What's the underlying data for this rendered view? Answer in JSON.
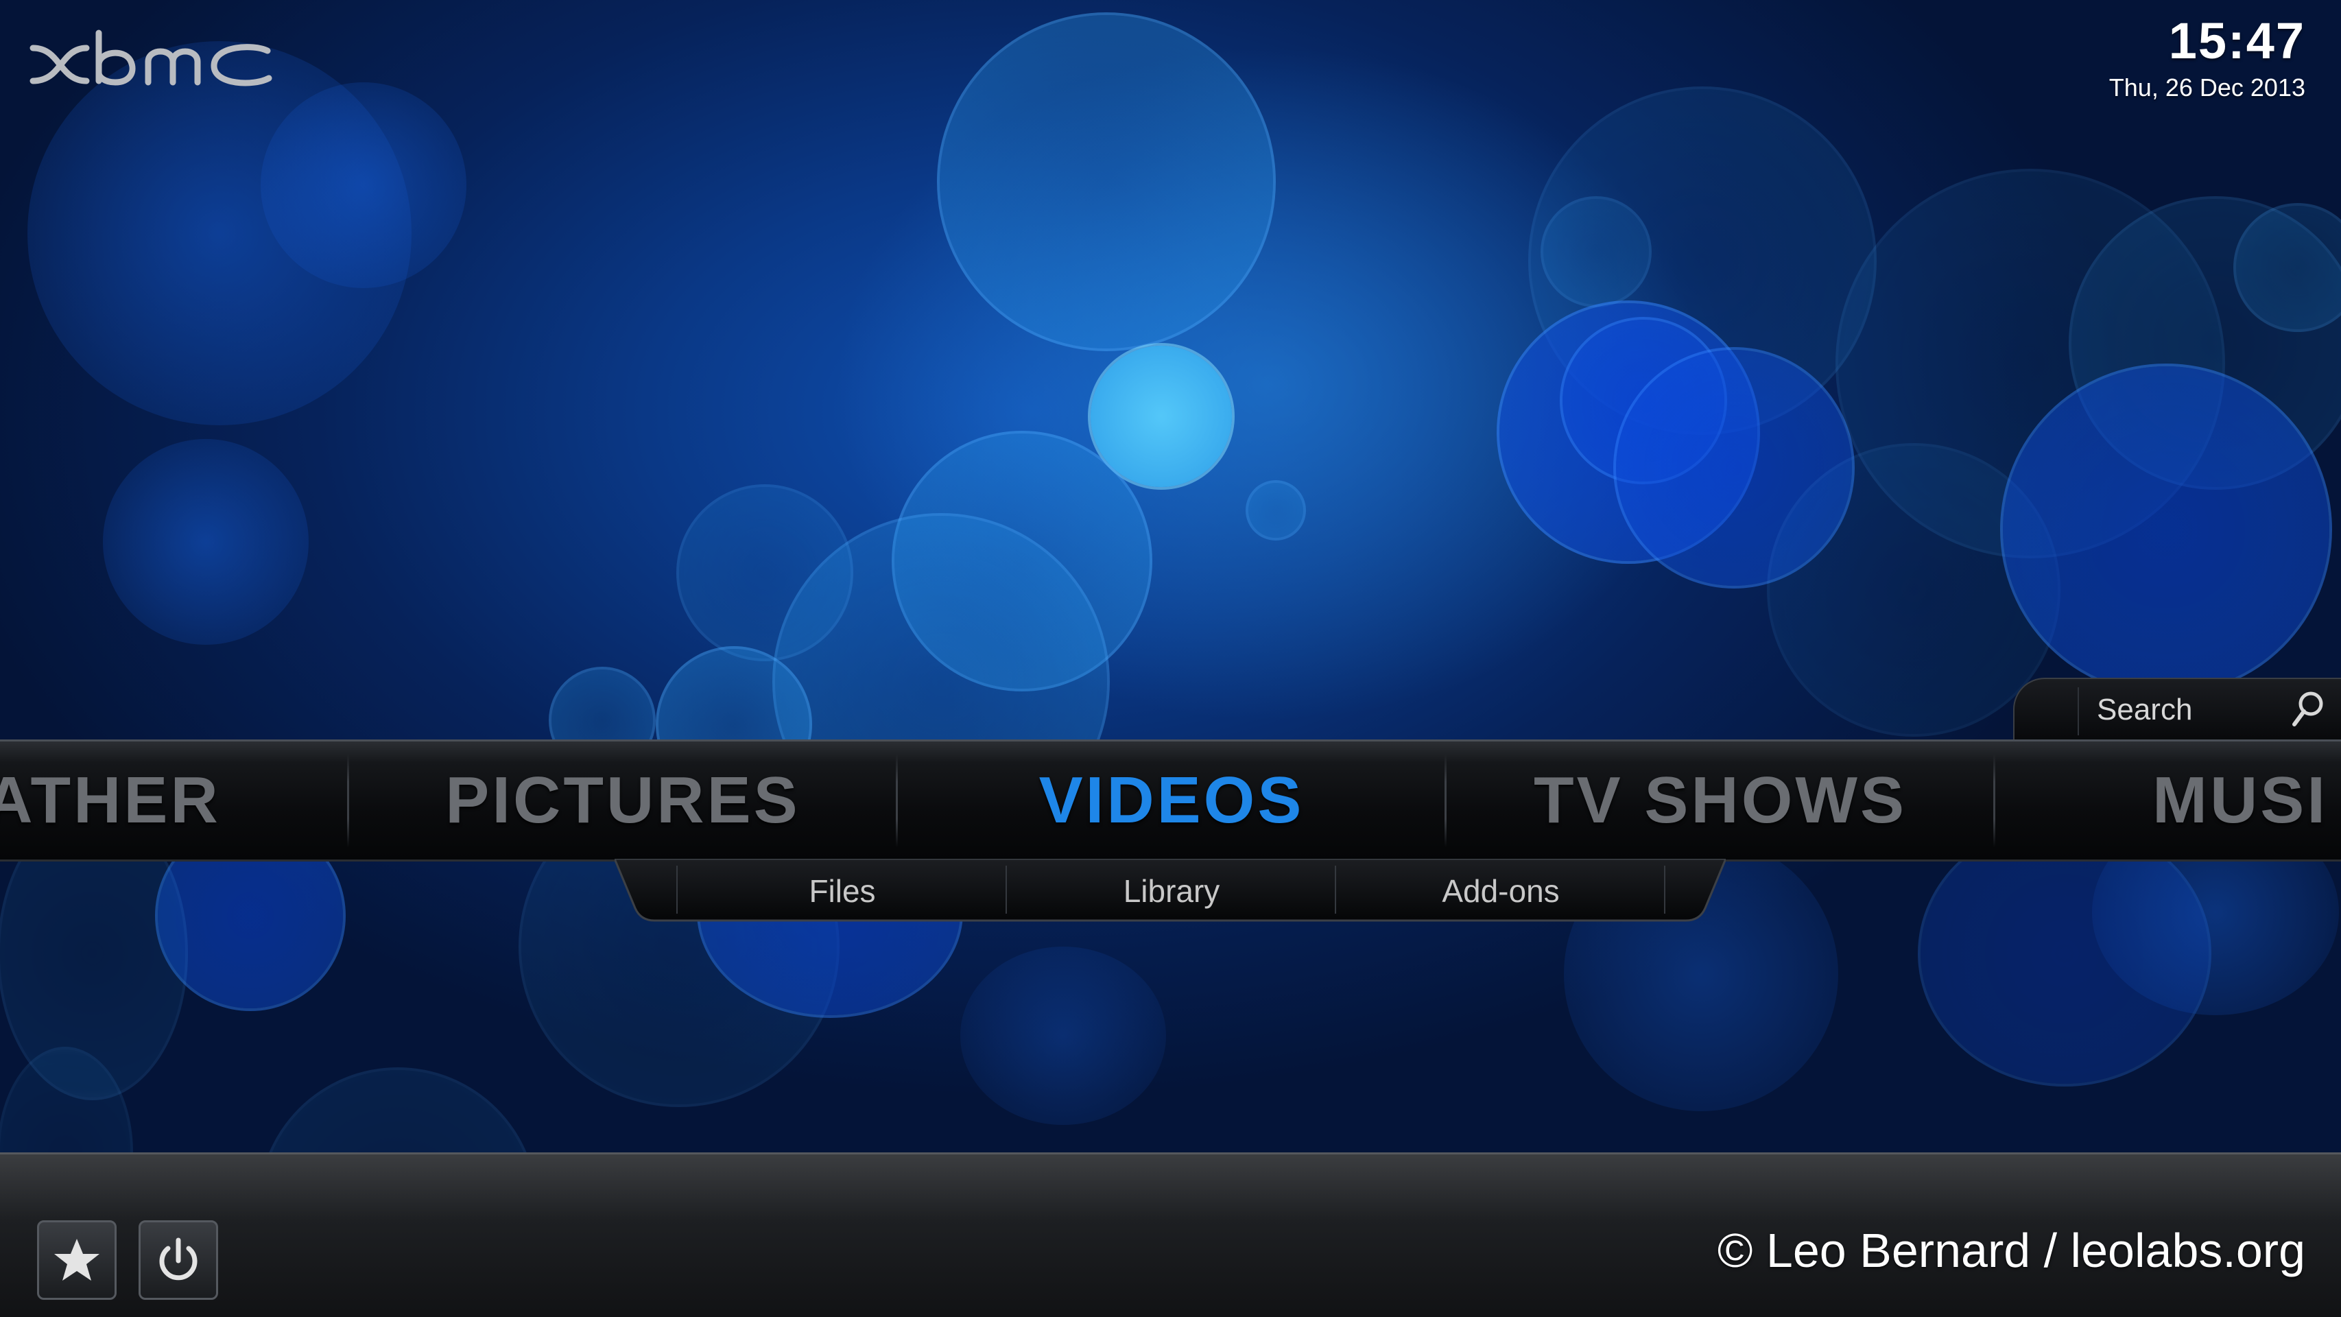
{
  "app": {
    "logo_text": "xbmc",
    "theme_accent": "#1e86e8"
  },
  "clock": {
    "time": "15:47",
    "date": "Thu, 26 Dec 2013"
  },
  "search": {
    "label": "Search",
    "icon": "search-icon"
  },
  "main_menu": {
    "items": [
      {
        "label": "WEATHER",
        "visible_text": "ATHER"
      },
      {
        "label": "PICTURES"
      },
      {
        "label": "VIDEOS",
        "active": true
      },
      {
        "label": "TV SHOWS"
      },
      {
        "label": "MUSIC",
        "visible_text": "MUSI"
      }
    ]
  },
  "sub_menu": {
    "items": [
      {
        "label": "Files"
      },
      {
        "label": "Library"
      },
      {
        "label": "Add-ons"
      }
    ]
  },
  "bottom_bar": {
    "favourites_icon": "star-icon",
    "power_icon": "power-icon",
    "credit": "© Leo Bernard / leolabs.org"
  }
}
